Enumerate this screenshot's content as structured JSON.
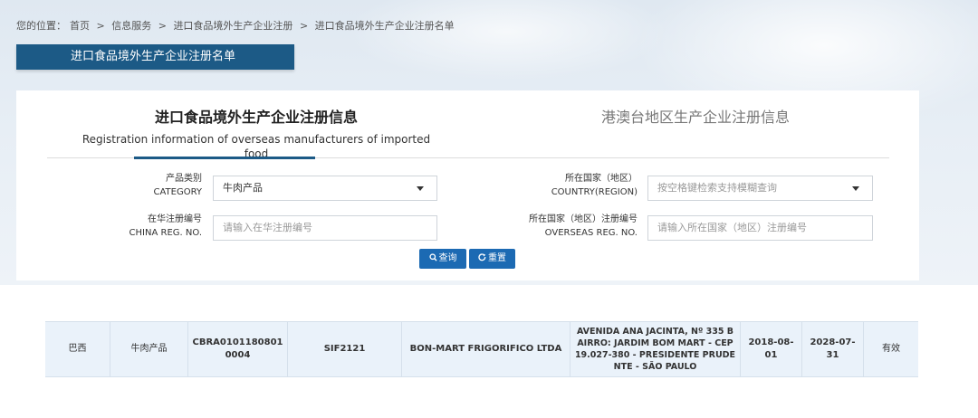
{
  "breadcrumb": {
    "prefix": "您的位置：",
    "items": [
      "首页",
      "信息服务",
      "进口食品境外生产企业注册",
      "进口食品境外生产企业注册名单"
    ],
    "separator": ">"
  },
  "page_title": "进口食品境外生产企业注册名单",
  "tabs": {
    "active": {
      "title_zh": "进口食品境外生产企业注册信息",
      "title_en": "Registration information of overseas manufacturers of imported food"
    },
    "other": {
      "title_zh": "港澳台地区生产企业注册信息"
    }
  },
  "form": {
    "category": {
      "label_zh": "产品类别",
      "label_en": "CATEGORY",
      "value": "牛肉产品"
    },
    "country": {
      "label_zh": "所在国家（地区）",
      "label_en": "COUNTRY(REGION)",
      "placeholder": "按空格键检索支持模糊查询"
    },
    "china_reg": {
      "label_zh": "在华注册编号",
      "label_en": "CHINA REG. NO.",
      "placeholder": "请输入在华注册编号"
    },
    "overseas_reg": {
      "label_zh": "所在国家（地区）注册编号",
      "label_en": "OVERSEAS REG. NO.",
      "placeholder": "请输入所在国家（地区）注册编号"
    },
    "search_label": "查询",
    "reset_label": "重置"
  },
  "results": {
    "rows": [
      {
        "country": "巴西",
        "category": "牛肉产品",
        "china_reg_no": "CBRA01011808010004",
        "overseas_reg_no": "SIF2121",
        "company": "BON-MART FRIGORIFICO LTDA",
        "address": "AVENIDA ANA JACINTA, Nº 335 BAIRRO: JARDIM BOM MART - CEP 19.027-380 - PRESIDENTE PRUDENTE - SÃO PAULO",
        "reg_date": "2018-08-01",
        "expiry_date": "2028-07-31",
        "status": "有效"
      }
    ]
  },
  "colors": {
    "primary": "#1c5a86",
    "button": "#1c6ab3",
    "row_bg": "#eaf2fa"
  }
}
